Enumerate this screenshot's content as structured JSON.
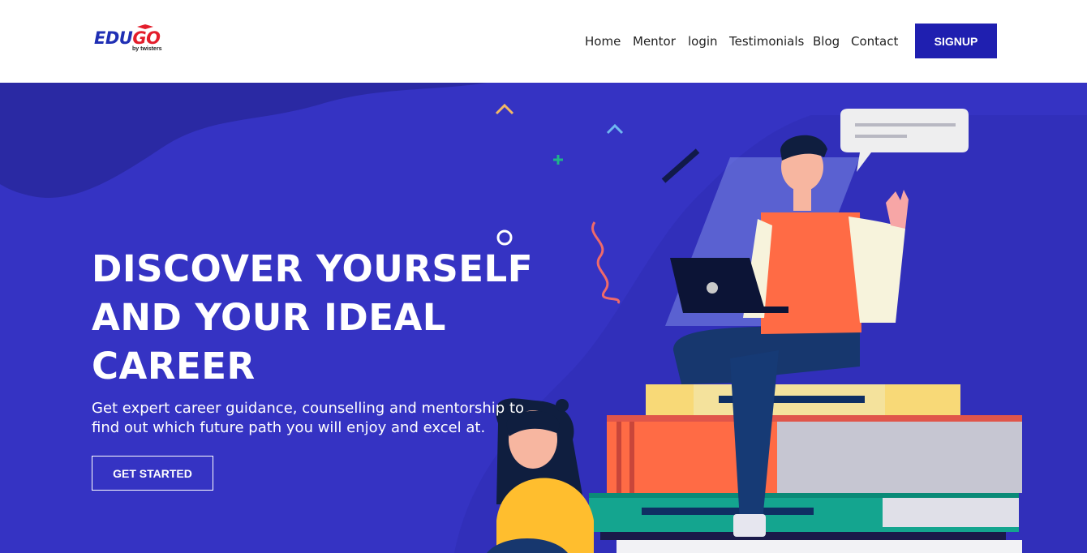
{
  "brand": {
    "logo_part1": "EDU",
    "logo_part2": "GO",
    "logo_sub": "by twisters",
    "primary_color": "#1f2fb4",
    "accent_color": "#e31d2b"
  },
  "nav": {
    "items": [
      {
        "label": "Home"
      },
      {
        "label": "Mentor"
      },
      {
        "label": "login"
      },
      {
        "label": "Testimonials"
      },
      {
        "label": "Blog"
      },
      {
        "label": "Contact"
      }
    ],
    "signup_label": "SIGNUP"
  },
  "hero": {
    "headline_line1": "DISCOVER YOURSELF",
    "headline_line2": "AND YOUR IDEAL",
    "headline_line3": "CAREER",
    "subtext": "Get expert career guidance, counselling and mentorship to find out which future path you will enjoy and excel at.",
    "cta_label": "GET STARTED",
    "background_color": "#3533c3"
  }
}
